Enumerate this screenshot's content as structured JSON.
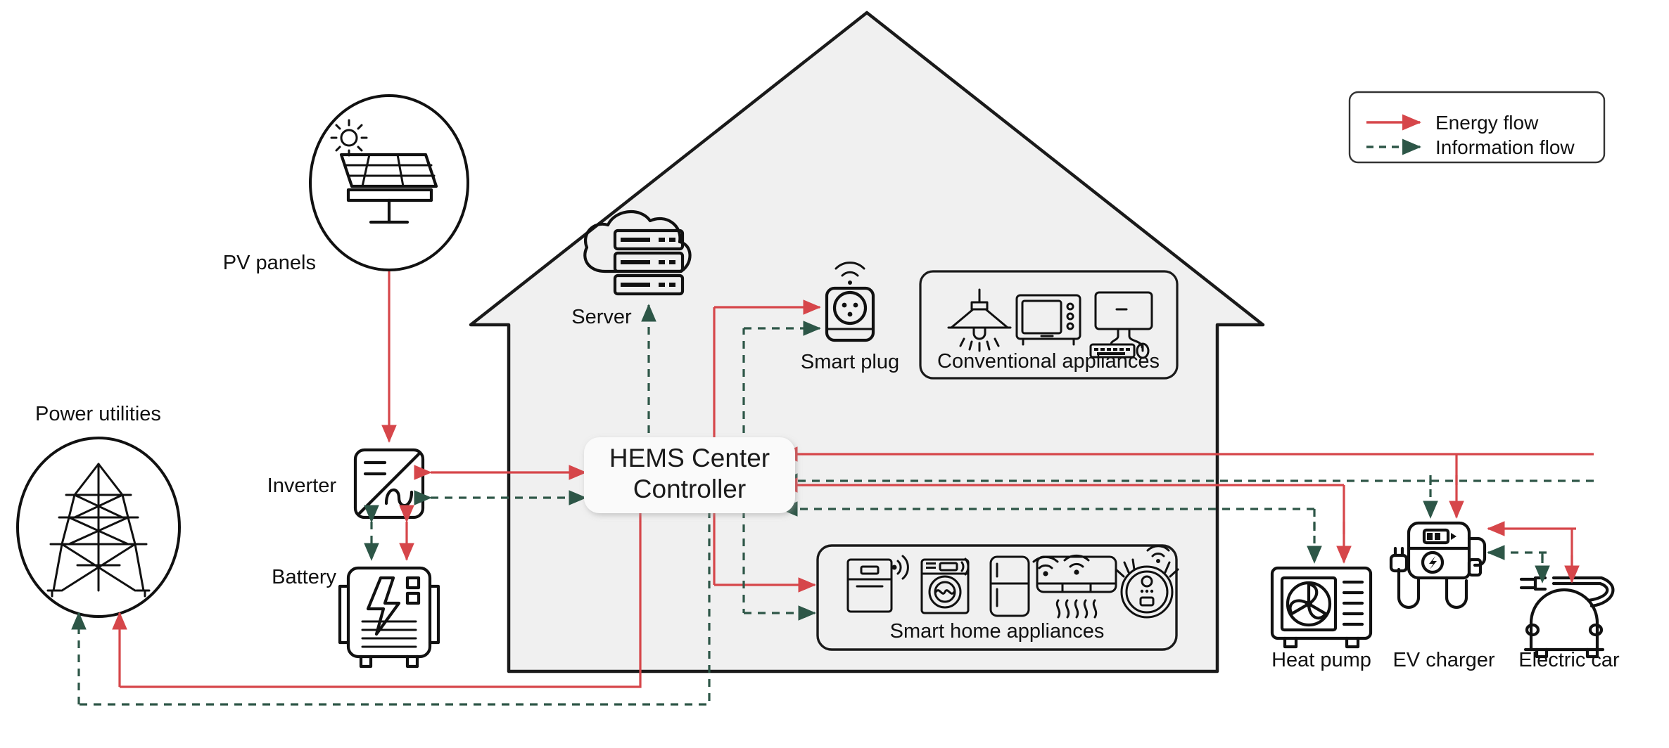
{
  "diagram": {
    "title": "Home Energy Management System (HEMS) architecture",
    "background_color": "#ffffff",
    "house_fill": "#f0f0f0",
    "house_stroke": "#1a1a1a"
  },
  "colors": {
    "energy_flow": "#d6464a",
    "information_flow": "#2d5647",
    "text": "#111111",
    "icon_stroke": "#111111"
  },
  "legend": {
    "items": [
      {
        "label": "Energy flow",
        "style": "solid",
        "color": "#d6464a",
        "icon": "arrow-right-icon"
      },
      {
        "label": "Information flow",
        "style": "dashed",
        "color": "#2d5647",
        "icon": "arrow-right-dashed-icon"
      }
    ]
  },
  "nodes": {
    "pv_panels": {
      "label": "PV panels",
      "icon": "solar-panel-icon",
      "shape": "circle"
    },
    "power_utilities": {
      "label": "Power utilities",
      "icon": "transmission-tower-icon",
      "shape": "circle"
    },
    "inverter": {
      "label": "Inverter",
      "icon": "inverter-icon"
    },
    "battery": {
      "label": "Battery",
      "icon": "battery-storage-icon"
    },
    "server": {
      "label": "Server",
      "icon": "cloud-server-icon"
    },
    "hems": {
      "label_line1": "HEMS Center",
      "label_line2": "Controller",
      "icon": "controller-box"
    },
    "smart_plug": {
      "label": "Smart plug",
      "icon": "smart-plug-icon"
    },
    "conventional_appliances": {
      "label": "Conventional appliances",
      "icons": [
        "pendant-lamp-icon",
        "microwave-oven-icon",
        "desktop-computer-icon"
      ]
    },
    "smart_home_appliances": {
      "label": "Smart home appliances",
      "icons": [
        "smart-dishwasher-icon",
        "smart-washing-machine-icon",
        "smart-refrigerator-icon",
        "smart-air-conditioner-icon",
        "robot-vacuum-icon"
      ]
    },
    "heat_pump": {
      "label": "Heat pump",
      "icon": "heat-pump-icon"
    },
    "ev_charger": {
      "label": "EV charger",
      "icon": "ev-charger-icon"
    },
    "electric_car": {
      "label": "Electric car",
      "icon": "electric-car-icon"
    }
  },
  "connections": [
    {
      "from": "pv_panels",
      "to": "inverter",
      "type": "energy",
      "direction": "one-way"
    },
    {
      "from": "inverter",
      "to": "hems",
      "type": "energy",
      "direction": "bidirectional"
    },
    {
      "from": "inverter",
      "to": "hems",
      "type": "information",
      "direction": "bidirectional"
    },
    {
      "from": "inverter",
      "to": "battery",
      "type": "energy",
      "direction": "bidirectional"
    },
    {
      "from": "inverter",
      "to": "battery",
      "type": "information",
      "direction": "bidirectional"
    },
    {
      "from": "hems",
      "to": "server",
      "type": "information",
      "direction": "bidirectional"
    },
    {
      "from": "hems",
      "to": "smart_plug",
      "type": "energy",
      "direction": "one-way"
    },
    {
      "from": "hems",
      "to": "smart_plug",
      "type": "information",
      "direction": "one-way"
    },
    {
      "from": "hems",
      "to": "smart_home_appliances",
      "type": "energy",
      "direction": "one-way"
    },
    {
      "from": "hems",
      "to": "smart_home_appliances",
      "type": "information",
      "direction": "one-way"
    },
    {
      "from": "heat_pump",
      "to": "hems",
      "type": "energy",
      "direction": "one-way"
    },
    {
      "from": "heat_pump",
      "to": "hems",
      "type": "information",
      "direction": "one-way"
    },
    {
      "from": "ev_charger",
      "to": "hems",
      "type": "energy",
      "direction": "one-way"
    },
    {
      "from": "ev_charger",
      "to": "hems",
      "type": "information",
      "direction": "one-way"
    },
    {
      "from": "ev_charger",
      "to": "electric_car",
      "type": "energy",
      "direction": "bidirectional"
    },
    {
      "from": "ev_charger",
      "to": "electric_car",
      "type": "information",
      "direction": "bidirectional"
    },
    {
      "from": "hems",
      "to": "power_utilities",
      "type": "energy",
      "direction": "one-way"
    },
    {
      "from": "hems",
      "to": "power_utilities",
      "type": "information",
      "direction": "one-way"
    }
  ]
}
